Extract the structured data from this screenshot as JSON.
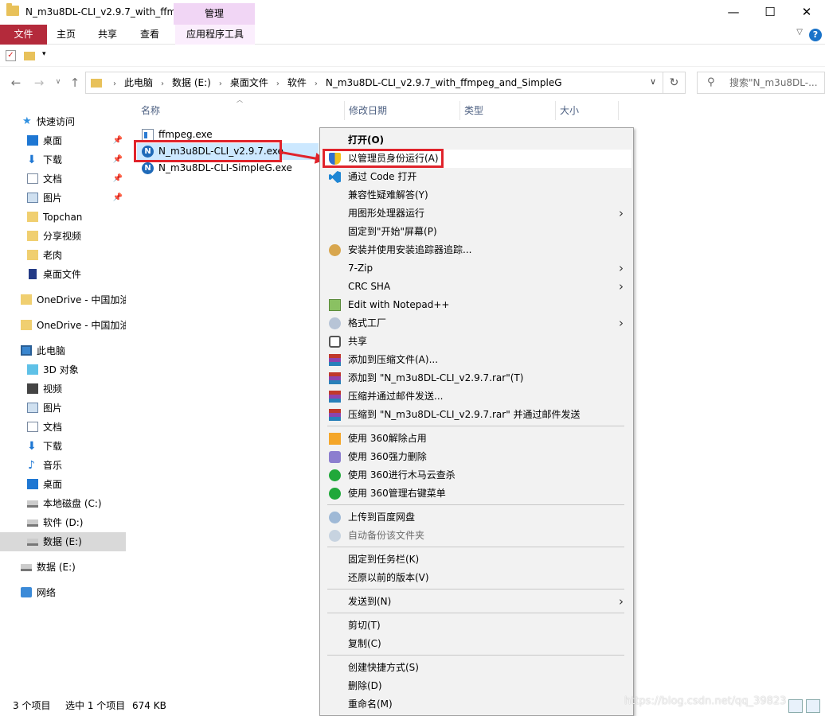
{
  "window": {
    "title": "N_m3u8DL-CLI_v2.9.7_with_ffm...",
    "context_tab": "管理",
    "minimize": "—",
    "maximize": "☐",
    "close": "✕"
  },
  "ribbon": {
    "tabs": [
      "文件",
      "主页",
      "共享",
      "查看",
      "应用程序工具"
    ],
    "help": "?"
  },
  "address": {
    "crumbs": [
      "此电脑",
      "数据 (E:)",
      "桌面文件",
      "软件",
      "N_m3u8DL-CLI_v2.9.7_with_ffmpeg_and_SimpleG"
    ],
    "search_placeholder": "搜索\"N_m3u8DL-...",
    "refresh": "↻"
  },
  "sidebar": {
    "quick_access": "快速访问",
    "quick_items": [
      {
        "label": "桌面",
        "pinned": true
      },
      {
        "label": "下载",
        "pinned": true
      },
      {
        "label": "文档",
        "pinned": true
      },
      {
        "label": "图片",
        "pinned": true
      },
      {
        "label": "Topchan"
      },
      {
        "label": "分享视频"
      },
      {
        "label": "老肉"
      },
      {
        "label": "桌面文件"
      }
    ],
    "onedrive": [
      "OneDrive - 中国加油",
      "OneDrive - 中国加油"
    ],
    "this_pc": "此电脑",
    "pc_items": [
      "3D 对象",
      "视频",
      "图片",
      "文档",
      "下载",
      "音乐",
      "桌面",
      "本地磁盘 (C:)",
      "软件 (D:)",
      "数据 (E:)"
    ],
    "drive_e": "数据 (E:)",
    "network": "网络"
  },
  "columns": {
    "name": "名称",
    "modified": "修改日期",
    "type": "类型",
    "size": "大小"
  },
  "files": [
    {
      "name": "ffmpeg.exe",
      "icon": "exe-icon"
    },
    {
      "name": "N_m3u8DL-CLI_v2.9.7.exe",
      "icon": "n-app-icon",
      "selected": true
    },
    {
      "name": "N_m3u8DL-CLI-SimpleG.exe",
      "icon": "n-app-icon"
    }
  ],
  "status": {
    "count": "3 个项目",
    "selected": "选中 1 个项目",
    "size": "674 KB"
  },
  "context_menu": {
    "items": [
      {
        "label": "打开(O)",
        "bold": true
      },
      {
        "label": "以管理员身份运行(A)",
        "icon": "shield-icon",
        "hover": true
      },
      {
        "label": "通过 Code 打开",
        "icon": "vscode-icon"
      },
      {
        "label": "兼容性疑难解答(Y)"
      },
      {
        "label": "用图形处理器运行",
        "submenu": true
      },
      {
        "label": "固定到\"开始\"屏幕(P)"
      },
      {
        "label": "安装并使用安装追踪器追踪...",
        "icon": "installer-icon"
      },
      {
        "label": "7-Zip",
        "submenu": true
      },
      {
        "label": "CRC SHA",
        "submenu": true
      },
      {
        "label": "Edit with Notepad++",
        "icon": "notepad-icon"
      },
      {
        "label": "格式工厂",
        "icon": "format-factory-icon",
        "submenu": true
      },
      {
        "label": "共享",
        "icon": "share-icon"
      },
      {
        "label": "添加到压缩文件(A)...",
        "icon": "winrar-icon"
      },
      {
        "label": "添加到 \"N_m3u8DL-CLI_v2.9.7.rar\"(T)",
        "icon": "winrar-icon"
      },
      {
        "label": "压缩并通过邮件发送...",
        "icon": "winrar-icon"
      },
      {
        "label": "压缩到 \"N_m3u8DL-CLI_v2.9.7.rar\" 并通过邮件发送",
        "icon": "winrar-icon"
      },
      {
        "label": "使用 360解除占用",
        "icon": "unlock-360-icon"
      },
      {
        "label": "使用 360强力删除",
        "icon": "shred-360-icon"
      },
      {
        "label": "使用 360进行木马云查杀",
        "icon": "scan-360-icon"
      },
      {
        "label": "使用 360管理右键菜单",
        "icon": "menu-360-icon"
      },
      {
        "label": "上传到百度网盘",
        "icon": "baidu-cloud-icon"
      },
      {
        "label": "自动备份该文件夹",
        "icon": "baidu-cloud-icon",
        "disabled": true
      },
      {
        "label": "固定到任务栏(K)"
      },
      {
        "label": "还原以前的版本(V)"
      },
      {
        "label": "发送到(N)",
        "submenu": true
      },
      {
        "label": "剪切(T)"
      },
      {
        "label": "复制(C)"
      },
      {
        "label": "创建快捷方式(S)"
      },
      {
        "label": "删除(D)"
      },
      {
        "label": "重命名(M)"
      }
    ]
  },
  "watermark": "https://blog.csdn.net/qq_39823",
  "colors": {
    "file_tab": "#b42a3b",
    "manage_tab": "#f1d6f5",
    "selection": "#cce8ff",
    "highlight_box": "#e0232b"
  }
}
